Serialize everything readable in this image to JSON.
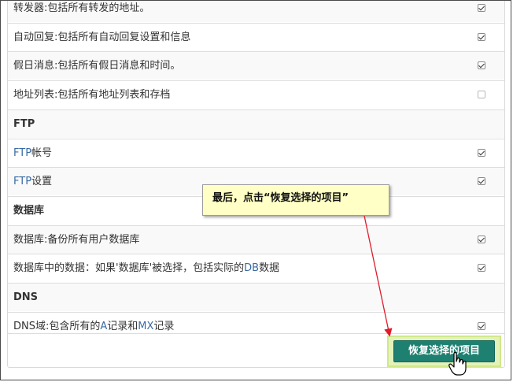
{
  "rows": [
    {
      "text": "转发器:包括所有转发的地址。",
      "checked": true
    },
    {
      "text": "自动回复:包括所有自动回复设置和信息",
      "checked": true
    },
    {
      "text": "假日消息:包括所有假日消息和时间。",
      "checked": true
    },
    {
      "text": "地址列表:包括所有地址列表和存档",
      "checked": false
    },
    {
      "section": "FTP"
    },
    {
      "prefix": "FTP",
      "text": "帐号",
      "checked": true
    },
    {
      "prefix": "FTP",
      "text": "设置",
      "checked": true
    },
    {
      "section": "数据库"
    },
    {
      "text": "数据库:备份所有用户数据库",
      "checked": true
    },
    {
      "text": "数据库中的数据：如果'数据库'被选择，包括实际的",
      "hl": "DB",
      "suffix": "数据",
      "checked": true
    },
    {
      "section": "DNS"
    },
    {
      "text": "DNS域:包含所有的",
      "hl": "A",
      "mid": "记录和",
      "hl2": "MX",
      "suffix": "记录",
      "checked": true
    }
  ],
  "callout": {
    "text": "最后，点击“恢复选择的项目”"
  },
  "restore_button": {
    "label": "恢复选择的项目"
  },
  "colors": {
    "accent": "#1e8070",
    "callout_bg": "#ffffc6",
    "arrow": "#e01b2a",
    "highlight": "#e4f2b9"
  },
  "icons": {
    "cursor": "hand-pointer-icon",
    "checkbox": "checkbox-icon"
  }
}
